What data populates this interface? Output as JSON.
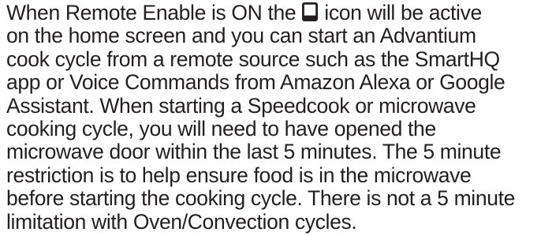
{
  "document": {
    "icon": "remote-enable-icon",
    "lines": [
      {
        "before_icon": "When Remote Enable is ON the ",
        "after_icon": " icon will be active"
      },
      {
        "text": "on the home screen and you can start an Advantium"
      },
      {
        "text": "cook cycle from a remote source such as the SmartHQ"
      },
      {
        "text": "app or Voice Commands from Amazon Alexa or Google"
      },
      {
        "text": "Assistant.  When starting a Speedcook or microwave"
      },
      {
        "text": "cooking cycle, you will need to have opened the"
      },
      {
        "text": "microwave door within the last 5 minutes.  The 5 minute"
      },
      {
        "text": "restriction is to help ensure food is in the microwave"
      },
      {
        "text": "before starting the cooking cycle.  There is not a 5 minute"
      },
      {
        "text": "limitation with Oven/Convection cycles."
      }
    ]
  }
}
